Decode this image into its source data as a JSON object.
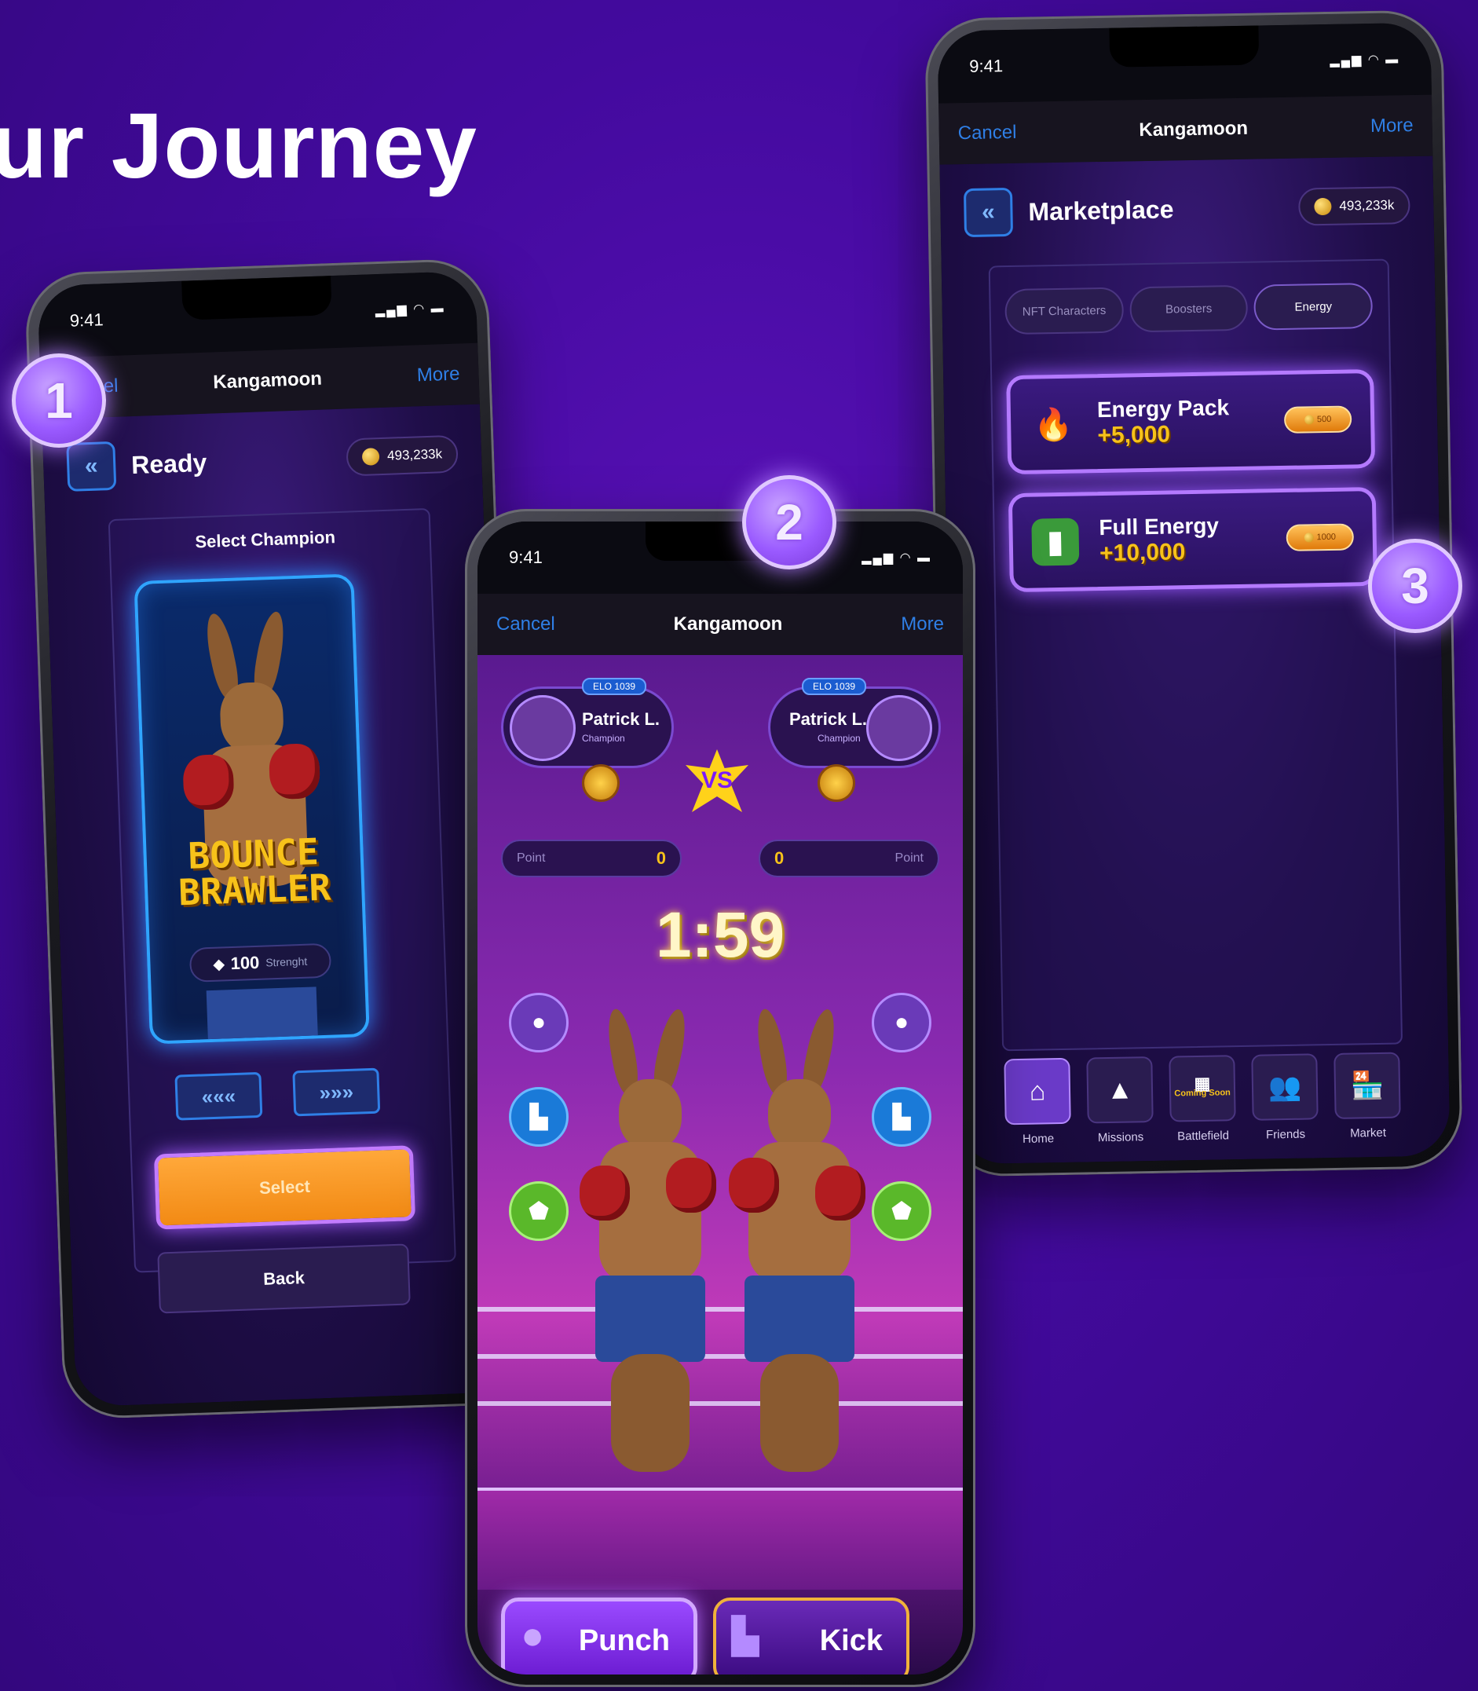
{
  "headline": "ur Journey",
  "status_time": "9:41",
  "header": {
    "cancel": "Cancel",
    "title": "Kangamoon",
    "more": "More"
  },
  "phone1": {
    "screen_title": "Ready",
    "coins": "493,233k",
    "select_champion": "Select Champion",
    "champion_name_line1": "BOUNCE",
    "champion_name_line2": "BRAWLER",
    "strength_value": "100",
    "strength_unit": "Strenght",
    "prev_icon": "«««",
    "next_icon": "»»»",
    "select_button": "Select",
    "back_button": "Back"
  },
  "phone2": {
    "player_left": {
      "name": "Patrick L.",
      "rank": "Champion",
      "elo": "ELO 1039"
    },
    "player_right": {
      "name": "Patrick L.",
      "rank": "Champion",
      "elo": "ELO 1039"
    },
    "vs": "VS",
    "point_label": "Point",
    "left_points": "0",
    "right_points": "0",
    "timer": "1:59",
    "punch_button": "Punch",
    "kick_button": "Kick"
  },
  "phone3": {
    "screen_title": "Marketplace",
    "coins": "493,233k",
    "tabs": [
      "NFT Characters",
      "Boosters",
      "Energy"
    ],
    "offers": [
      {
        "name": "Energy Pack",
        "amount": "+5,000",
        "price": "500",
        "icon": "fire-icon"
      },
      {
        "name": "Full Energy",
        "amount": "+10,000",
        "price": "1000",
        "icon": "battery-icon"
      }
    ],
    "nav": [
      "Home",
      "Missions",
      "Battlefield",
      "Friends",
      "Market"
    ],
    "coming_soon": "Coming Soon"
  },
  "steps": [
    "1",
    "2",
    "3"
  ],
  "colors": {
    "background": "#430a9e",
    "accent_purple": "#b47aff",
    "link_blue": "#2f7fe6",
    "gold": "#f7c21a"
  }
}
